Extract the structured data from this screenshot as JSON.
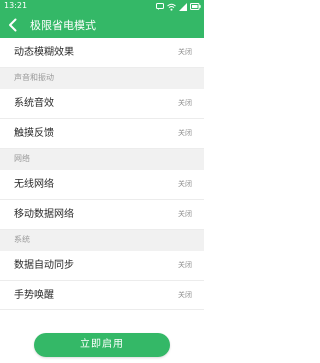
{
  "status_bar": {
    "time": "13:21",
    "icons": [
      "message-icon",
      "wifi-icon",
      "signal-icon",
      "battery-icon"
    ]
  },
  "header": {
    "title": "极限省电模式",
    "back_icon": "back-arrow-icon"
  },
  "settings": [
    {
      "type": "row",
      "label": "动态模糊效果",
      "value": "关闭"
    },
    {
      "type": "section",
      "label": "声音和振动"
    },
    {
      "type": "row",
      "label": "系统音效",
      "value": "关闭"
    },
    {
      "type": "row",
      "label": "触摸反馈",
      "value": "关闭"
    },
    {
      "type": "section",
      "label": "网络"
    },
    {
      "type": "row",
      "label": "无线网络",
      "value": "关闭"
    },
    {
      "type": "row",
      "label": "移动数据网络",
      "value": "关闭"
    },
    {
      "type": "section",
      "label": "系统"
    },
    {
      "type": "row",
      "label": "数据自动同步",
      "value": "关闭"
    },
    {
      "type": "row",
      "label": "手势唤醒",
      "value": "关闭"
    }
  ],
  "footer": {
    "button_label": "立即启用"
  },
  "colors": {
    "accent": "#34b867",
    "section_bg": "#f1f1f1",
    "value_text": "#8d8d8d"
  }
}
